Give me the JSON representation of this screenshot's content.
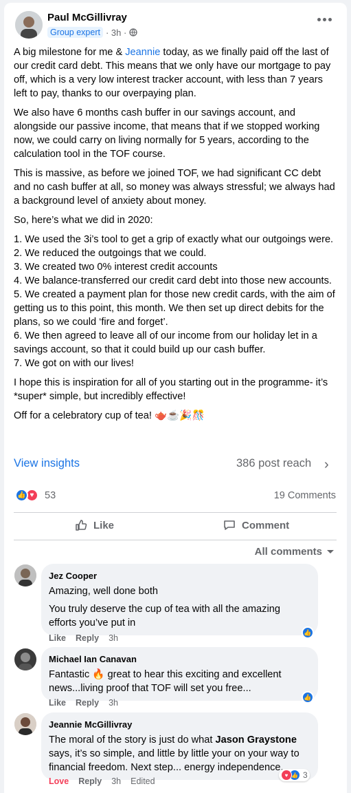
{
  "post": {
    "author": "Paul McGillivray",
    "badge": "Group expert",
    "time": "3h",
    "audience_icon": "globe-icon",
    "mentioned": "Jeannie",
    "intro_before": "A big milestone for me & ",
    "intro_after": " today, as we finally paid off the last of our credit card debt. This means that we only have our mortgage to pay off, which is a very low interest tracker account, with less than 7 years left to pay, thanks to our overpaying plan.",
    "paragraphs": [
      "We also have 6 months cash buffer in our savings account, and alongside our passive income, that means that if we stopped working now, we could carry on living normally for 5 years, according to the calculation tool in the TOF course.",
      "This is massive, as before we joined TOF, we had significant CC debt and no cash buffer at all, so money was always stressful; we always had a background level of anxiety about money.",
      "So, here’s what we did in 2020:"
    ],
    "steps": [
      "1. We used the 3i’s tool to get a grip of exactly what our outgoings were.",
      "2. We reduced the outgoings that we could.",
      "3. We created two 0% interest credit accounts",
      "4. We balance-transferred our credit card debt into those new accounts.",
      "5. We created a payment plan for those new credit cards, with the aim of getting us to this point, this month. We then set up direct debits for the plans, so we could ‘fire and forget’.",
      "6. We then agreed to leave all of our income from our holiday let in a savings account, so that it could build up our cash buffer.",
      "7. We got on with our lives!"
    ],
    "closing": "I hope this is inspiration for all of you starting out in the programme- it’s *super* simple, but incredibly effective!",
    "final": "Off for a celebratory cup of tea! 🫖☕🎉🎊"
  },
  "insights": {
    "label": "View insights",
    "reach": "386 post reach"
  },
  "stats": {
    "reactions": "53",
    "comments": "19 Comments"
  },
  "actions": {
    "like": "Like",
    "comment": "Comment"
  },
  "filter": {
    "label": "All comments"
  },
  "comments": [
    {
      "name": "Jez Cooper",
      "lines": [
        "Amazing, well done both",
        "You truly deserve the cup of tea with all the amazing efforts you’ve put in"
      ],
      "like": "Like",
      "reply": "Reply",
      "time": "3h"
    },
    {
      "name": "Michael Ian Canavan",
      "text": "Fantastic 🔥 great to hear this exciting and excellent news...living proof that TOF will set you free...",
      "like": "Like",
      "reply": "Reply",
      "time": "3h"
    },
    {
      "name": "Jeannie McGillivray",
      "before": "The moral of the story is just do what ",
      "bold": "Jason Graystone",
      "after": " says, it’s so simple, and little by little your on your way to financial freedom. Next step... energy independence.",
      "like": "Love",
      "reply": "Reply",
      "time": "3h",
      "edited": "Edited",
      "reaction_count": "3"
    }
  ],
  "colors": {
    "accent": "#1b74e4",
    "love": "#f33e58",
    "muted": "#65676b"
  }
}
